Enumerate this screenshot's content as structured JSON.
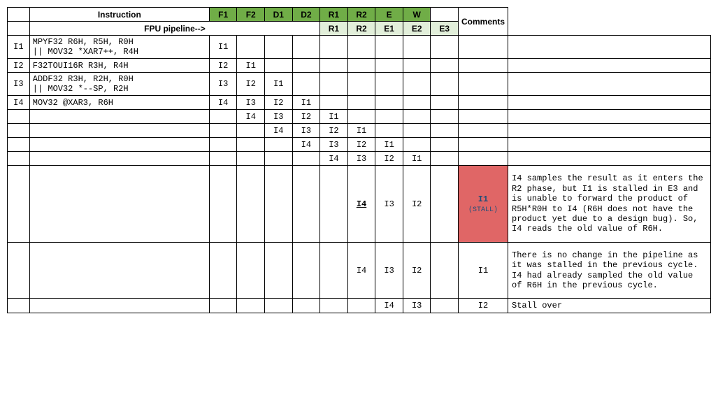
{
  "header": {
    "instruction": "Instruction",
    "comments": "Comments",
    "fpu_pipeline": "FPU pipeline-->",
    "stages_row1": [
      "F1",
      "F2",
      "D1",
      "D2",
      "R1",
      "R2",
      "E",
      "W"
    ],
    "stages_row2": [
      "R1",
      "R2",
      "E1",
      "E2",
      "E3"
    ]
  },
  "instructions": [
    {
      "id": "I1",
      "text": "MPYF32 R6H, R5H, R0H\n|| MOV32 *XAR7++, R4H"
    },
    {
      "id": "I2",
      "text": "F32TOUI16R R3H, R4H"
    },
    {
      "id": "I3",
      "text": "ADDF32 R3H, R2H, R0H\n|| MOV32 *--SP, R2H"
    },
    {
      "id": "I4",
      "text": "MOV32 @XAR3, R6H"
    }
  ],
  "rows": [
    {
      "id": "I1",
      "instr": 0,
      "stages": [
        "I1",
        "",
        "",
        "",
        "",
        "",
        "",
        "",
        "",
        ""
      ],
      "comment": ""
    },
    {
      "id": "I2",
      "instr": 1,
      "stages": [
        "I2",
        "I1",
        "",
        "",
        "",
        "",
        "",
        "",
        "",
        ""
      ],
      "comment": ""
    },
    {
      "id": "I3",
      "instr": 2,
      "stages": [
        "I3",
        "I2",
        "I1",
        "",
        "",
        "",
        "",
        "",
        "",
        ""
      ],
      "comment": ""
    },
    {
      "id": "I4",
      "instr": 3,
      "stages": [
        "I4",
        "I3",
        "I2",
        "I1",
        "",
        "",
        "",
        "",
        "",
        ""
      ],
      "comment": ""
    },
    {
      "id": "",
      "instr": -1,
      "stages": [
        "",
        "I4",
        "I3",
        "I2",
        "I1",
        "",
        "",
        "",
        "",
        ""
      ],
      "comment": ""
    },
    {
      "id": "",
      "instr": -1,
      "stages": [
        "",
        "",
        "I4",
        "I3",
        "I2",
        "I1",
        "",
        "",
        "",
        ""
      ],
      "comment": ""
    },
    {
      "id": "",
      "instr": -1,
      "stages": [
        "",
        "",
        "",
        "I4",
        "I3",
        "I2",
        "I1",
        "",
        "",
        ""
      ],
      "comment": ""
    },
    {
      "id": "",
      "instr": -1,
      "stages": [
        "",
        "",
        "",
        "",
        "I4",
        "I3",
        "I2",
        "I1",
        "",
        ""
      ],
      "comment": ""
    },
    {
      "id": "",
      "instr": -1,
      "stages": [
        "",
        "",
        "",
        "",
        "",
        "I4",
        "I3",
        "I2",
        "",
        "I1\n(STALL)"
      ],
      "comment": "I4 samples the result as it enters the R2 phase, but I1 is stalled in E3 and is unable to forward the product of R5H*R0H to I4 (R6H does not have the product yet due to a design bug). So, I4 reads the old value of R6H.",
      "stall": 9,
      "r2_ul": 5,
      "height": "tall"
    },
    {
      "id": "",
      "instr": -1,
      "stages": [
        "",
        "",
        "",
        "",
        "",
        "I4",
        "I3",
        "I2",
        "",
        "I1"
      ],
      "comment": "There is no change in the pipeline as it was stalled in the previous cycle. I4 had already sampled the old value of R6H in the previous cycle.",
      "height": "medium"
    },
    {
      "id": "",
      "instr": -1,
      "stages": [
        "",
        "",
        "",
        "",
        "",
        "",
        "I4",
        "I3",
        "",
        "I2"
      ],
      "comment": "Stall over"
    }
  ]
}
